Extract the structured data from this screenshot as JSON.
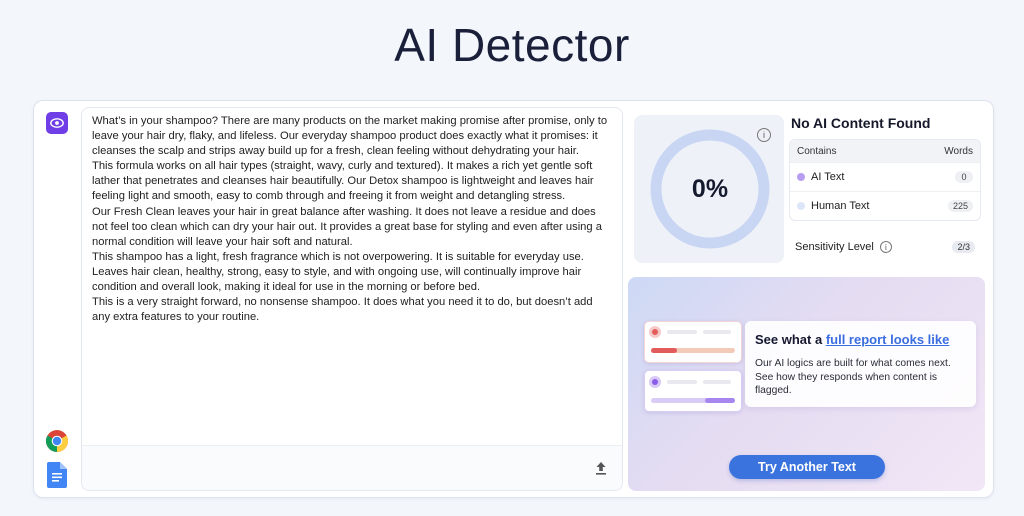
{
  "header": {
    "title": "AI Detector"
  },
  "article": {
    "paragraphs": [
      "What’s in your shampoo? There are many products on the market making promise after promise, only to leave your hair dry, flaky, and lifeless. Our everyday shampoo product does exactly what it promises: it cleanses the scalp and strips away build up for a fresh, clean feeling without dehydrating your hair.",
      "This formula works on all hair types (straight, wavy, curly and textured). It makes a rich yet gentle soft lather that penetrates and cleanses hair beautifully. Our Detox shampoo is lightweight and leaves hair feeling light and smooth, easy to comb through and freeing it from weight and detangling stress.",
      "Our Fresh Clean leaves your hair in great balance after washing. It does not leave a residue and does not feel too clean which can dry your hair out. It provides a great base for styling and even after using a normal condition will leave your hair soft and natural.",
      "This shampoo has a light, fresh fragrance which is not overpowering. It is suitable for everyday use. Leaves hair clean, healthy, strong, easy to style, and with ongoing use, will continually improve hair condition and overall look, making it ideal for use in the morning or before bed.",
      "This is a very straight forward, no nonsense shampoo. It does what you need it to do, but doesn’t add any extra features to your routine."
    ]
  },
  "result": {
    "score_text": "0%",
    "score_fraction": 0,
    "title": "No AI Content Found",
    "table": {
      "col_contains": "Contains",
      "col_words": "Words",
      "rows": [
        {
          "label": "AI Text",
          "count": "0",
          "dot_color": "#b79ef0"
        },
        {
          "label": "Human Text",
          "count": "225",
          "dot_color": "#dde6f8"
        }
      ]
    },
    "sensitivity": {
      "label": "Sensitivity Level",
      "value": "2/3"
    }
  },
  "promo": {
    "heading_prefix": "See what a ",
    "heading_link": "full report looks like",
    "body": "Our AI logics are built for what comes next. See how they responds when content is flagged.",
    "button_label": "Try Another Text"
  },
  "colors": {
    "accent": "#6f3ee6",
    "button": "#3b73de",
    "gauge_ring": "#c9d6f3"
  },
  "icons": {
    "rail": [
      "eye-icon",
      "chrome-icon",
      "google-docs-icon"
    ],
    "upload": "upload-icon",
    "info": "info-icon"
  }
}
